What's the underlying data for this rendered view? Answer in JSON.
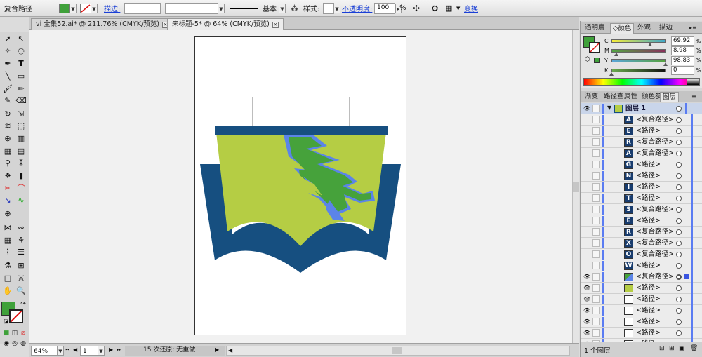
{
  "control_bar": {
    "selection_label": "复合路径",
    "fill_color": "#3fa13a",
    "stroke_label": "描边:",
    "stroke_weight": "",
    "variable_width": "",
    "brush_name": "基本",
    "style_label": "样式:",
    "opacity_label": "不透明度:",
    "opacity_value": "100",
    "opacity_unit": "%",
    "transform_label": "变换"
  },
  "doc_tabs": [
    {
      "label": "vi 全集52.ai* @ 211.76% (CMYK/预览)",
      "active": false
    },
    {
      "label": "未标题-5* @ 64% (CMYK/预览)",
      "active": true
    }
  ],
  "status_bar": {
    "zoom": "64%",
    "artboard_number": "1",
    "undo_status": "15 次还原; 无重做"
  },
  "panels": {
    "top_tabs": [
      "透明度",
      "颜色",
      "外观",
      "描边"
    ],
    "active_top_tab": "颜色",
    "color": {
      "fill": "#3fa13a",
      "channels": [
        {
          "label": "C",
          "value": "69.92",
          "unit": "%",
          "level": 0.6992,
          "gradient": "linear-gradient(to right,#f6ec3a,#3fa7c9)"
        },
        {
          "label": "M",
          "value": "8.98",
          "unit": "%",
          "level": 0.0898,
          "gradient": "linear-gradient(to right,#53a542,#8a2f5c)"
        },
        {
          "label": "Y",
          "value": "98.83",
          "unit": "%",
          "level": 0.9883,
          "gradient": "linear-gradient(to right,#5aa6d8,#56a23c)"
        },
        {
          "label": "K",
          "value": "0",
          "unit": "%",
          "level": 0.0,
          "gradient": "linear-gradient(to right,#6aab4d,#111)"
        }
      ]
    },
    "lower_tabs": [
      "渐变",
      "路径查",
      "属性",
      "颜色参",
      "图层"
    ],
    "active_lower_tab": "图层",
    "layers": {
      "layer_name": "图层 1",
      "items": [
        {
          "thumb": "A",
          "name": "<复合路径>"
        },
        {
          "thumb": "E",
          "name": "<路径>"
        },
        {
          "thumb": "R",
          "name": "<复合路径>"
        },
        {
          "thumb": "A",
          "name": "<复合路径>"
        },
        {
          "thumb": "G",
          "name": "<路径>"
        },
        {
          "thumb": "N",
          "name": "<路径>"
        },
        {
          "thumb": "I",
          "name": "<路径>"
        },
        {
          "thumb": "T",
          "name": "<路径>"
        },
        {
          "thumb": "S",
          "name": "<复合路径>"
        },
        {
          "thumb": "E",
          "name": "<路径>"
        },
        {
          "thumb": "R",
          "name": "<复合路径>"
        },
        {
          "thumb": "X",
          "name": "<复合路径>"
        },
        {
          "thumb": "O",
          "name": "<复合路径>"
        },
        {
          "thumb": "W",
          "name": "<路径>"
        },
        {
          "thumb": "",
          "name": "<复合路径>",
          "selected": true
        },
        {
          "thumb": "",
          "name": "<路径>"
        },
        {
          "thumb": "",
          "name": "<路径>"
        },
        {
          "thumb": "",
          "name": "<路径>"
        },
        {
          "thumb": "",
          "name": "<路径>"
        },
        {
          "thumb": "",
          "name": "<路径>"
        },
        {
          "thumb": "",
          "name": "<路径>"
        }
      ],
      "footer": "1 个图层"
    }
  },
  "artwork_colors": {
    "navy": "#164f80",
    "lime": "#b5cd44",
    "green": "#46a23b",
    "blue": "#5b84e8",
    "gray": "#bdbdbd"
  }
}
